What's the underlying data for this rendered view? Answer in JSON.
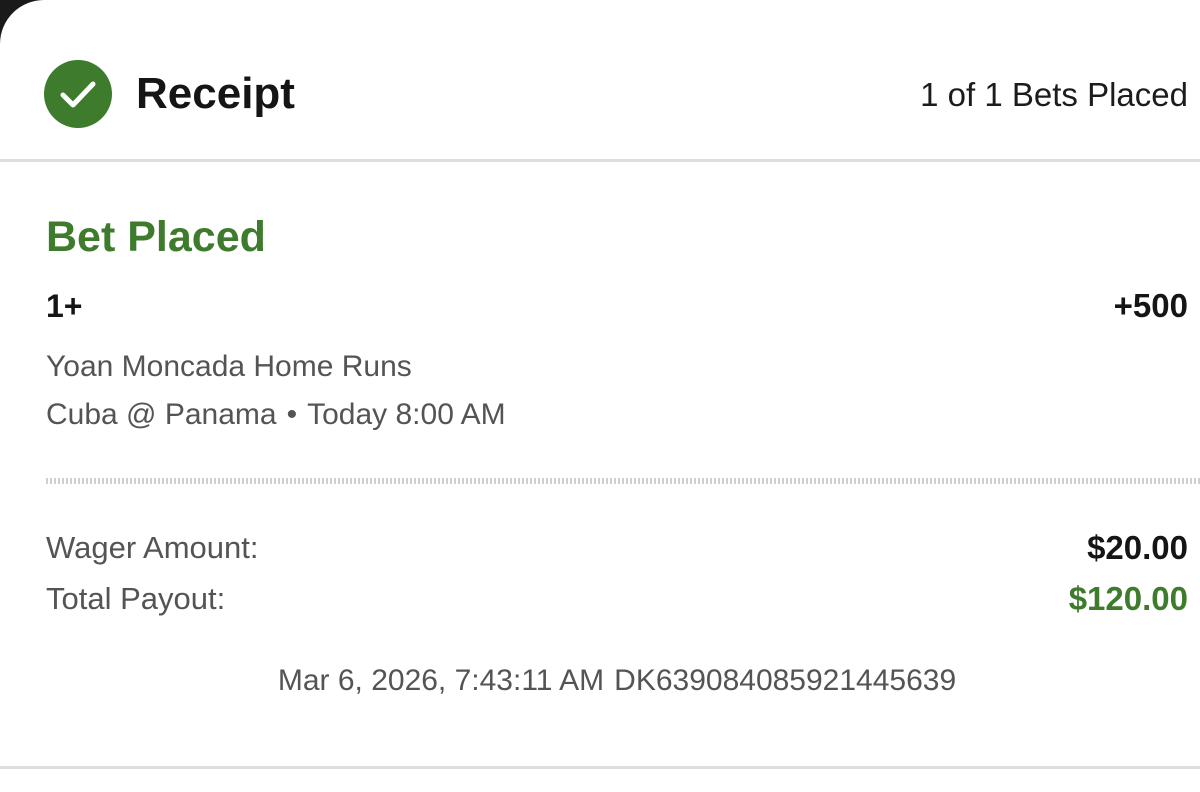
{
  "header": {
    "title": "Receipt",
    "bets_count": "1 of 1 Bets Placed"
  },
  "bet": {
    "status": "Bet Placed",
    "selection": "1+",
    "odds": "+500",
    "market": "Yoan Moncada Home Runs",
    "event": "Cuba @ Panama",
    "separator": "•",
    "start_time": "Today 8:00 AM"
  },
  "summary": {
    "wager_label": "Wager Amount:",
    "wager_value": "$20.00",
    "payout_label": "Total Payout:",
    "payout_value": "$120.00"
  },
  "footer": {
    "timestamp": "Mar 6, 2026, 7:43:11 AM",
    "bet_id": "DK639084085921445639"
  },
  "colors": {
    "accent_green": "#3e7b2c",
    "text_primary": "#151515",
    "text_secondary": "#545454",
    "divider": "#dedede"
  },
  "icons": {
    "status": "checkmark-circle-icon"
  }
}
